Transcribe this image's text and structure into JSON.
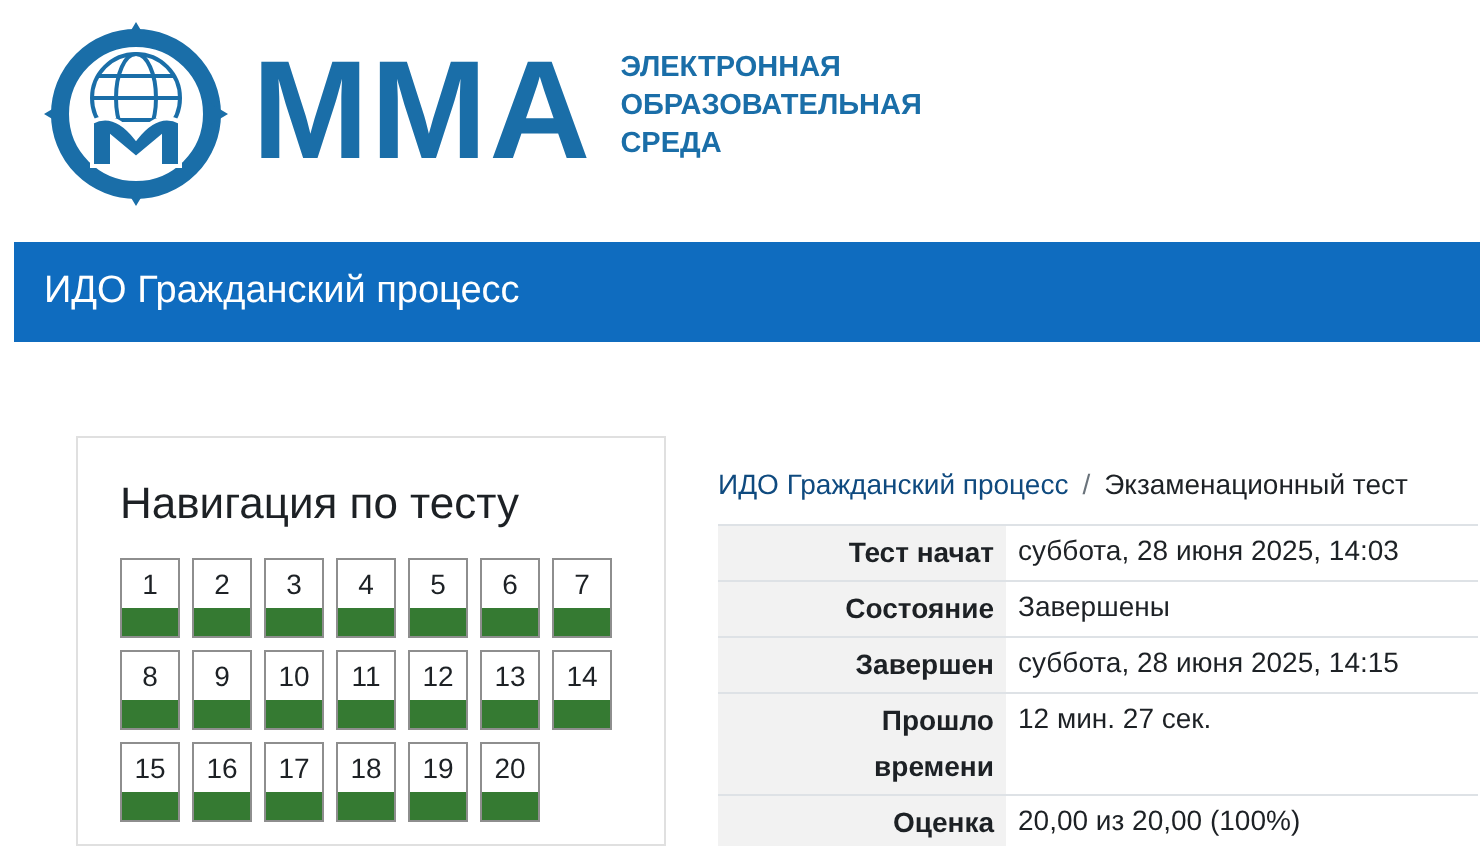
{
  "header": {
    "logo_text": "ММА",
    "logo_subtitle": [
      "ЭЛЕКТРОННАЯ",
      "ОБРАЗОВАТЕЛЬНАЯ",
      "СРЕДА"
    ]
  },
  "course_bar": {
    "title": "ИДО Гражданский процесс"
  },
  "quiz_navigation": {
    "title": "Навигация по тесту",
    "questions": [
      {
        "label": "1",
        "answered": true
      },
      {
        "label": "2",
        "answered": true
      },
      {
        "label": "3",
        "answered": true
      },
      {
        "label": "4",
        "answered": true
      },
      {
        "label": "5",
        "answered": true
      },
      {
        "label": "6",
        "answered": true
      },
      {
        "label": "7",
        "answered": true
      },
      {
        "label": "8",
        "answered": true
      },
      {
        "label": "9",
        "answered": true
      },
      {
        "label": "10",
        "answered": true
      },
      {
        "label": "11",
        "answered": true
      },
      {
        "label": "12",
        "answered": true
      },
      {
        "label": "13",
        "answered": true
      },
      {
        "label": "14",
        "answered": true
      },
      {
        "label": "15",
        "answered": true
      },
      {
        "label": "16",
        "answered": true
      },
      {
        "label": "17",
        "answered": true
      },
      {
        "label": "18",
        "answered": true
      },
      {
        "label": "19",
        "answered": true
      },
      {
        "label": "20",
        "answered": true
      }
    ]
  },
  "breadcrumb": {
    "items": [
      "ИДО Гражданский процесс",
      "Экзаменационный тест"
    ],
    "separator": "/"
  },
  "summary": [
    {
      "label": "Тест начат",
      "value": "суббота, 28 июня 2025, 14:03"
    },
    {
      "label": "Состояние",
      "value": "Завершены"
    },
    {
      "label": "Завершен",
      "value": "суббота, 28 июня 2025, 14:15"
    },
    {
      "label": "Прошло времени",
      "value": "12 мин. 27 сек."
    },
    {
      "label": "Оценка",
      "value": "20,00 из 20,00 (100%)"
    }
  ]
}
